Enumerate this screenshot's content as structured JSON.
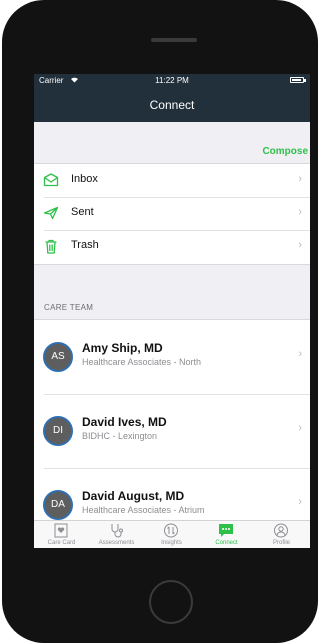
{
  "status": {
    "carrier": "Carrier",
    "time": "11:22 PM"
  },
  "navbar": {
    "title": "Connect"
  },
  "compose_label": "Compose",
  "mailboxes": [
    {
      "label": "Inbox",
      "icon": "inbox-icon"
    },
    {
      "label": "Sent",
      "icon": "paper-plane-icon"
    },
    {
      "label": "Trash",
      "icon": "trash-icon"
    }
  ],
  "care_team": {
    "header": "CARE TEAM",
    "members": [
      {
        "initials": "AS",
        "name": "Amy Ship, MD",
        "org": "Healthcare Associates - North"
      },
      {
        "initials": "DI",
        "name": "David Ives, MD",
        "org": "BIDHC - Lexington"
      },
      {
        "initials": "DA",
        "name": "David August, MD",
        "org": "Healthcare Associates -  Atrium"
      }
    ]
  },
  "tabs": [
    {
      "label": "Care Card",
      "icon": "care-card-icon"
    },
    {
      "label": "Assessments",
      "icon": "stethoscope-icon"
    },
    {
      "label": "Insights",
      "icon": "insights-icon"
    },
    {
      "label": "Connect",
      "icon": "chat-icon",
      "active": true
    },
    {
      "label": "Profile",
      "icon": "profile-icon"
    }
  ],
  "colors": {
    "accent": "#2fc04a",
    "navbar": "#22303c",
    "avatar_ring": "#2f6fb0"
  }
}
